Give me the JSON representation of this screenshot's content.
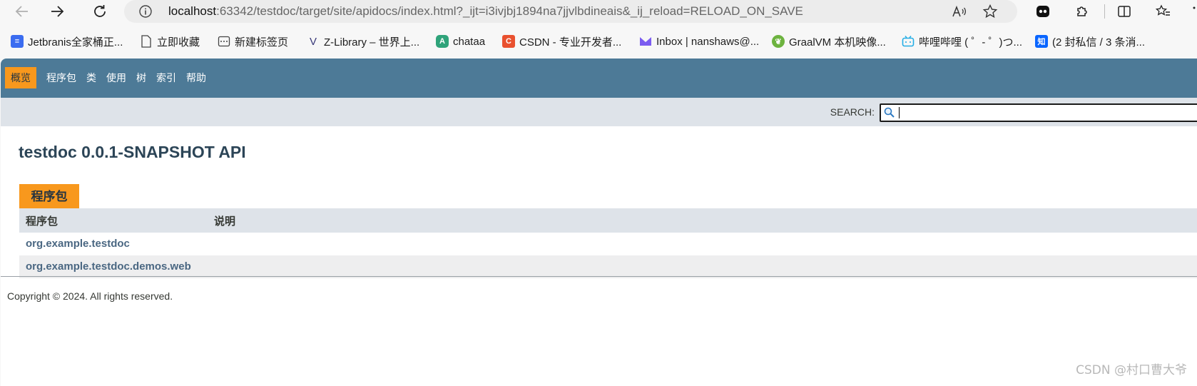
{
  "browser": {
    "url_host": "localhost",
    "url_rest": ":63342/testdoc/target/site/apidocs/index.html?_ijt=i3ivjbj1894na7jjvlbdineais&_ij_reload=RELOAD_ON_SAVE",
    "bookmarks": [
      {
        "label": "Jetbranis全家桶正...",
        "icon": "doc-blue-icon",
        "color": "#3b6cf0"
      },
      {
        "label": "立即收藏",
        "icon": "page-icon",
        "color": "#555555"
      },
      {
        "label": "新建标签页",
        "icon": "tab-icon",
        "color": "#444444"
      },
      {
        "label": "Z-Library – 世界上...",
        "icon": "zlibrary-icon",
        "color": "#3a3a7a"
      },
      {
        "label": "chataa",
        "icon": "chataa-icon",
        "color": "#2fa37a"
      },
      {
        "label": "CSDN - 专业开发者...",
        "icon": "csdn-icon",
        "color": "#e9512f"
      },
      {
        "label": "Inbox | nanshaws@...",
        "icon": "proton-icon",
        "color": "#7b5cf0"
      },
      {
        "label": "GraalVM 本机映像...",
        "icon": "spring-icon",
        "color": "#6db33f"
      },
      {
        "label": "哔哩哔哩 ( ゜- ゜)つ...",
        "icon": "bilibili-icon",
        "color": "#23ade5"
      },
      {
        "label": "(2 封私信 / 3 条消...",
        "icon": "zhihu-icon",
        "color": "#0a66ff"
      }
    ]
  },
  "nav": {
    "items": [
      "概览",
      "程序包",
      "类",
      "使用",
      "树",
      "索引",
      "帮助"
    ],
    "active_index": 0
  },
  "search": {
    "label": "SEARCH:",
    "value": ""
  },
  "main": {
    "title": "testdoc 0.0.1-SNAPSHOT API",
    "caption": "程序包",
    "columns": [
      "程序包",
      "说明"
    ],
    "packages": [
      {
        "name": "org.example.testdoc",
        "description": ""
      },
      {
        "name": "org.example.testdoc.demos.web",
        "description": ""
      }
    ]
  },
  "footer": {
    "copyright": "Copyright © 2024. All rights reserved."
  },
  "watermark": "CSDN @村口曹大爷"
}
